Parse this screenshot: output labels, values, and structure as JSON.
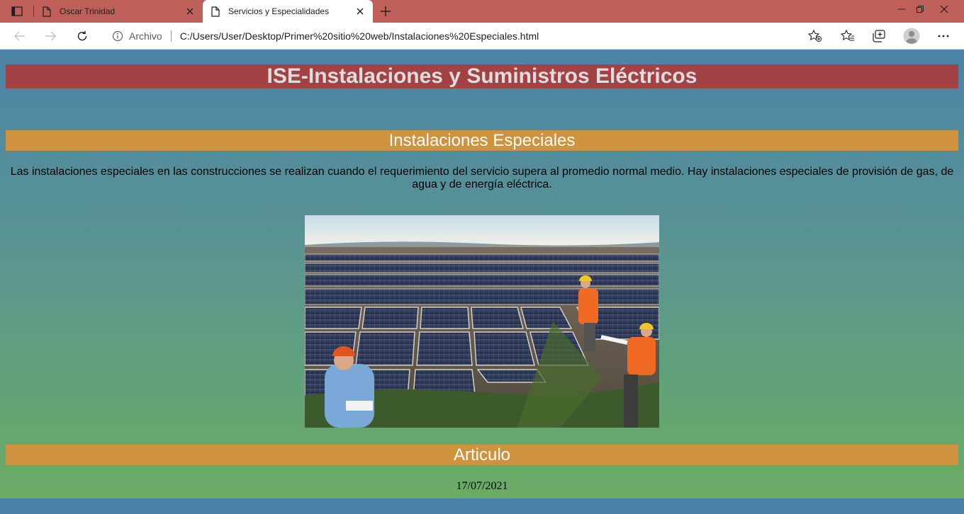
{
  "browser": {
    "tabs": [
      {
        "label": "Oscar Trinidad",
        "active": false
      },
      {
        "label": "Servicios y Especialidades",
        "active": true
      }
    ],
    "address": {
      "scheme_label": "Archivo",
      "url": "C:/Users/User/Desktop/Primer%20sitio%20web/Instalaciones%20Especiales.html"
    },
    "icons": {
      "tab_actions": "tab-actions-icon",
      "page": "page-icon",
      "close": "close-icon",
      "new_tab": "plus-icon",
      "back": "back-arrow-icon",
      "forward": "forward-arrow-icon",
      "refresh": "refresh-icon",
      "info": "info-icon",
      "add_favorite": "star-add-icon",
      "favorites": "favorites-icon",
      "collections": "collections-icon",
      "profile": "profile-icon",
      "more": "more-icon"
    },
    "colors": {
      "tabbar": "#bf5f5a",
      "toolbar": "#ffffff"
    }
  },
  "page": {
    "site_title": "ISE-Instalaciones y Suministros Eléctricos",
    "section1_title": "Instalaciones Especiales",
    "intro_text": "Las instalaciones especiales en las construcciones se realizan cuando el requerimiento del servicio supera al promedio normal medio. Hay instalaciones especiales de provisión de gas, de agua y de energía eléctrica.",
    "section2_title": "Articulo",
    "date": "17/07/2021",
    "colors": {
      "title_bar": "#a34245",
      "section_bar": "#cf923e",
      "background_top": "#4b84a7",
      "background_bottom": "#6aac63"
    }
  }
}
